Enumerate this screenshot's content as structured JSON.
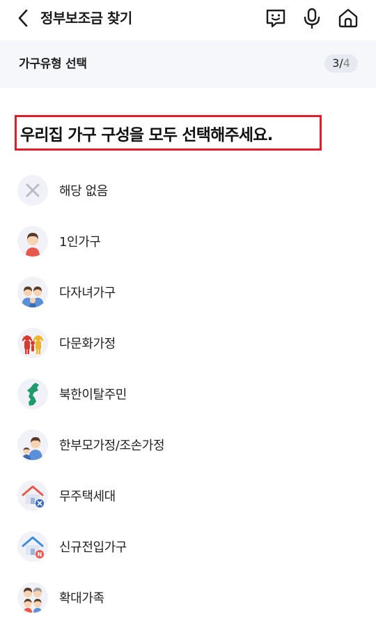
{
  "header": {
    "title": "정부보조금 찾기",
    "icons": [
      "back-icon",
      "chatbot-icon",
      "microphone-icon",
      "home-icon"
    ]
  },
  "step": {
    "label": "가구유형 선택",
    "current": "3",
    "separator": "/",
    "total": "4"
  },
  "question": "우리집 가구 구성을 모두 선택해주세요.",
  "options": [
    {
      "label": "해당 없음",
      "icon": "none-x-icon"
    },
    {
      "label": "1인가구",
      "icon": "single-person-icon"
    },
    {
      "label": "다자녀가구",
      "icon": "multi-child-family-icon"
    },
    {
      "label": "다문화가정",
      "icon": "multicultural-family-icon"
    },
    {
      "label": "북한이탈주민",
      "icon": "korea-map-icon"
    },
    {
      "label": "한부모가정/조손가정",
      "icon": "single-parent-icon"
    },
    {
      "label": "무주택세대",
      "icon": "house-no-icon"
    },
    {
      "label": "신규전입가구",
      "icon": "house-new-icon"
    },
    {
      "label": "확대가족",
      "icon": "extended-family-icon"
    }
  ]
}
